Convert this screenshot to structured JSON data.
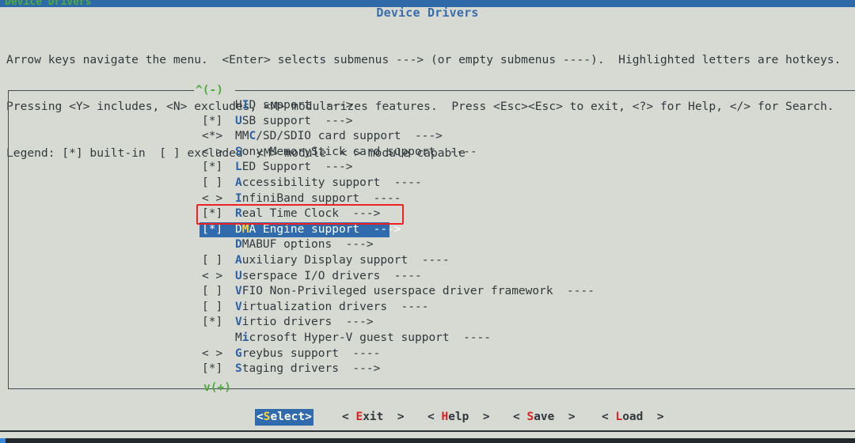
{
  "window": {
    "titlebar_text": "Device Drivers",
    "titlebar_color": "#3069a8",
    "titlebar_text_color": "#4faa3d"
  },
  "dialog": {
    "title": "Device Drivers",
    "title_color": "#3a6cab",
    "background_color": "#d6dad2",
    "foreground_color": "#32393e"
  },
  "help": {
    "line1": "Arrow keys navigate the menu.  <Enter> selects submenus ---> (or empty submenus ----).  Highlighted letters are hotkeys.",
    "line2": "Pressing <Y> includes, <N> excludes, <M> modularizes features.  Press <Esc><Esc> to exit, <?> for Help, </> for Search.",
    "line3": "Legend: [*] built-in  [ ] excluded  <M> module  < > module capable"
  },
  "scroll": {
    "up_indicator": "^(-)",
    "down_indicator": "v(+)",
    "indicator_color": "#4faa3d"
  },
  "menu": {
    "selected_index": 8,
    "highlight_bg": "#2f6bad",
    "highlight_fg": "#ffffff",
    "hotkey_color": "#2d62a6",
    "selected_hotkey_color": "#ffd43b",
    "items": [
      {
        "mark": "    ",
        "pre": "H",
        "hotkey": "I",
        "post": "D support",
        "arrow": "  --->"
      },
      {
        "mark": "[*] ",
        "pre": "",
        "hotkey": "U",
        "post": "SB support",
        "arrow": "  --->"
      },
      {
        "mark": "<*> ",
        "pre": "MM",
        "hotkey": "C",
        "post": "/SD/SDIO card support",
        "arrow": "  --->"
      },
      {
        "mark": "< > ",
        "pre": "",
        "hotkey": "S",
        "post": "ony MemoryStick card support",
        "arrow": "  ----"
      },
      {
        "mark": "[*] ",
        "pre": "",
        "hotkey": "L",
        "post": "ED Support",
        "arrow": "  --->"
      },
      {
        "mark": "[ ] ",
        "pre": "",
        "hotkey": "A",
        "post": "ccessibility support",
        "arrow": "  ----"
      },
      {
        "mark": "< > ",
        "pre": "",
        "hotkey": "I",
        "post": "nfiniBand support",
        "arrow": "  ----"
      },
      {
        "mark": "[*] ",
        "pre": "",
        "hotkey": "R",
        "post": "eal Time Clock",
        "arrow": "  --->"
      },
      {
        "mark": "[*] ",
        "pre": "D",
        "hotkey": "M",
        "post": "A Engine support",
        "arrow": "  --->"
      },
      {
        "mark": "    ",
        "pre": "",
        "hotkey": "D",
        "post": "MABUF options",
        "arrow": "  --->"
      },
      {
        "mark": "[ ] ",
        "pre": "",
        "hotkey": "A",
        "post": "uxiliary Display support",
        "arrow": "  ----"
      },
      {
        "mark": "< > ",
        "pre": "",
        "hotkey": "U",
        "post": "serspace I/O drivers",
        "arrow": "  ----"
      },
      {
        "mark": "[ ] ",
        "pre": "",
        "hotkey": "V",
        "post": "FIO Non-Privileged userspace driver framework",
        "arrow": "  ----"
      },
      {
        "mark": "[ ] ",
        "pre": "",
        "hotkey": "V",
        "post": "irtualization drivers",
        "arrow": "  ----"
      },
      {
        "mark": "[*] ",
        "pre": "",
        "hotkey": "V",
        "post": "irtio drivers",
        "arrow": "  --->"
      },
      {
        "mark": "    ",
        "pre": "M",
        "hotkey": "i",
        "post": "crosoft Hyper-V guest support",
        "arrow": "  ----"
      },
      {
        "mark": "< > ",
        "pre": "",
        "hotkey": "G",
        "post": "reybus support",
        "arrow": "  ----"
      },
      {
        "mark": "[*] ",
        "pre": "",
        "hotkey": "S",
        "post": "taging drivers",
        "arrow": "  --->"
      }
    ]
  },
  "buttons": {
    "active_index": 0,
    "items": [
      {
        "pre": "<",
        "hotkey": "S",
        "post": "elect>"
      },
      {
        "pre": "< ",
        "hotkey": "E",
        "post": "xit  >"
      },
      {
        "pre": "< ",
        "hotkey": "H",
        "post": "elp  >"
      },
      {
        "pre": "< ",
        "hotkey": "S",
        "post": "ave  >"
      },
      {
        "pre": "< ",
        "hotkey": "L",
        "post": "oad  >"
      }
    ]
  },
  "annotation": {
    "type": "red-rectangle-highlight",
    "target": "Real Time Clock",
    "color": "#ee2222"
  }
}
